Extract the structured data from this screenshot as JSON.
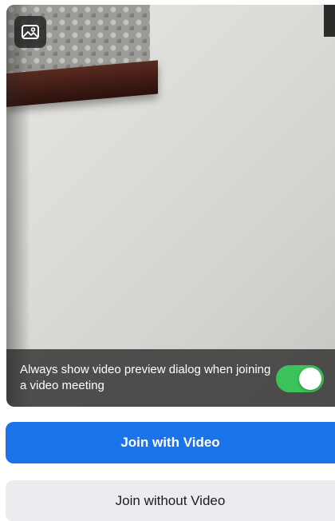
{
  "preview": {
    "background_button_icon": "image-icon"
  },
  "setting": {
    "text": "Always show video preview dialog when joining a video meeting",
    "toggle_on": true,
    "toggle_color": "#3cc25a"
  },
  "buttons": {
    "join_with_video": "Join with Video",
    "join_without_video": "Join without Video"
  },
  "colors": {
    "primary": "#1a73e8",
    "secondary_bg": "#ececf0"
  }
}
